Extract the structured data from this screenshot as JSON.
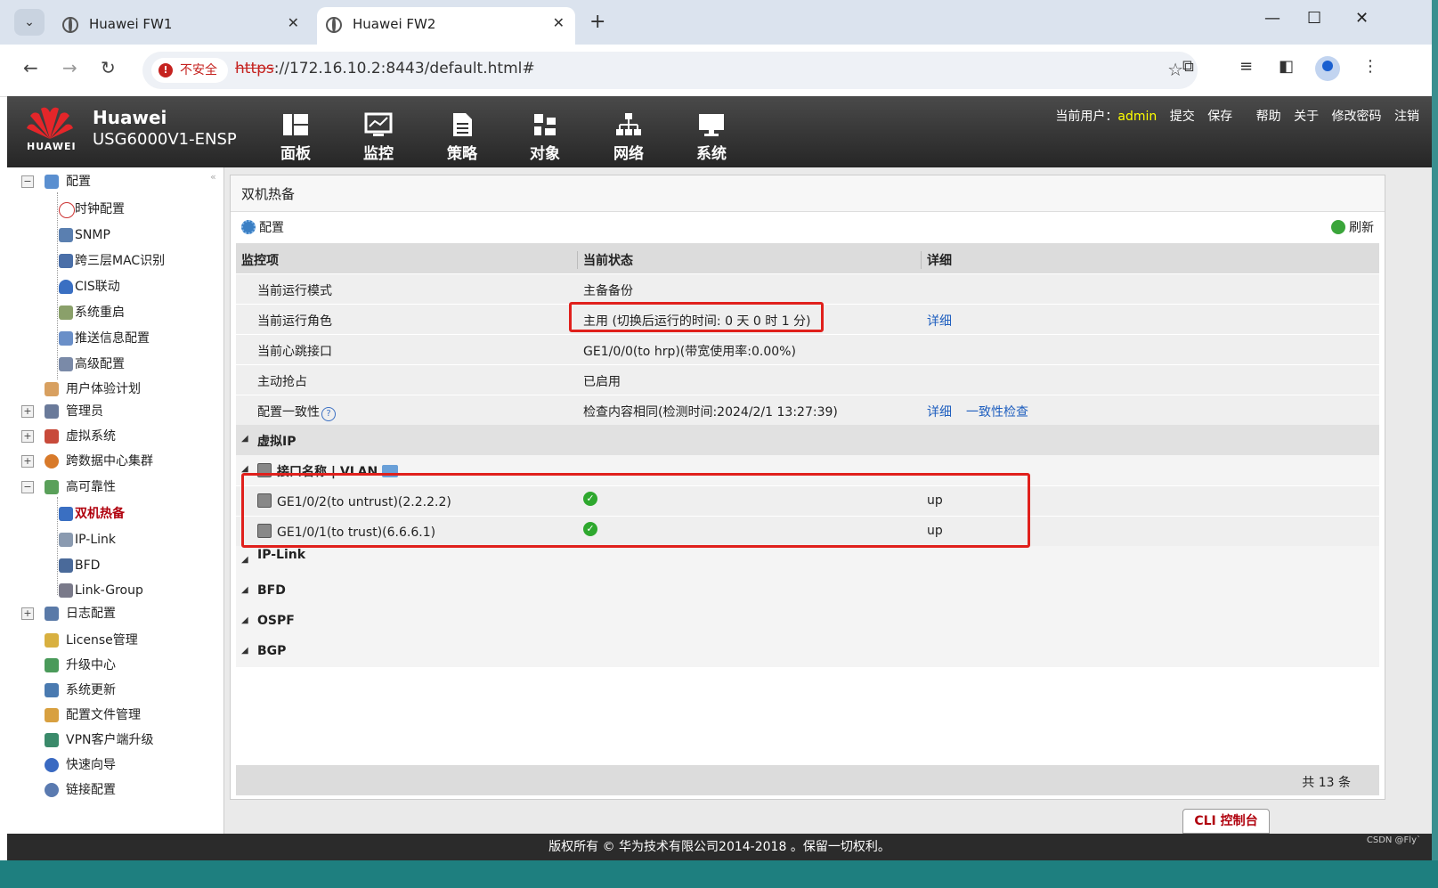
{
  "browser": {
    "tabs": [
      {
        "title": "Huawei FW1"
      },
      {
        "title": "Huawei FW2"
      }
    ],
    "security_label": "不安全",
    "url_scheme": "https",
    "url_rest": "://172.16.10.2:8443/default.html#"
  },
  "app": {
    "brand_logo_text": "HUAWEI",
    "brand_name": "Huawei",
    "model": "USG6000V1-ENSP",
    "nav": [
      "面板",
      "监控",
      "策略",
      "对象",
      "网络",
      "系统"
    ],
    "user_label": "当前用户：",
    "user_name": "admin",
    "user_links": [
      "提交",
      "保存",
      "帮助",
      "关于",
      "修改密码",
      "注销"
    ]
  },
  "sidebar": {
    "items": [
      {
        "label": "配置"
      },
      {
        "label": "时钟配置"
      },
      {
        "label": "SNMP"
      },
      {
        "label": "跨三层MAC识别"
      },
      {
        "label": "CIS联动"
      },
      {
        "label": "系统重启"
      },
      {
        "label": "推送信息配置"
      },
      {
        "label": "高级配置"
      },
      {
        "label": "用户体验计划"
      },
      {
        "label": "管理员"
      },
      {
        "label": "虚拟系统"
      },
      {
        "label": "跨数据中心集群"
      },
      {
        "label": "高可靠性"
      },
      {
        "label": "双机热备"
      },
      {
        "label": "IP-Link"
      },
      {
        "label": "BFD"
      },
      {
        "label": "Link-Group"
      },
      {
        "label": "日志配置"
      },
      {
        "label": "License管理"
      },
      {
        "label": "升级中心"
      },
      {
        "label": "系统更新"
      },
      {
        "label": "配置文件管理"
      },
      {
        "label": "VPN客户端升级"
      },
      {
        "label": "快速向导"
      },
      {
        "label": "链接配置"
      }
    ]
  },
  "main": {
    "panel_title": "双机热备",
    "config_label": "配置",
    "refresh_label": "刷新",
    "columns": [
      "监控项",
      "当前状态",
      "详细"
    ],
    "rows": [
      {
        "item": "当前运行模式",
        "status": "主备备份",
        "detail": ""
      },
      {
        "item": "当前运行角色",
        "status": "主用 (切换后运行的时间: 0 天 0 时 1 分)",
        "detail": "详细"
      },
      {
        "item": "当前心跳接口",
        "status": "GE1/0/0(to hrp)(带宽使用率:0.00%)",
        "detail": ""
      },
      {
        "item": "主动抢占",
        "status": "已启用",
        "detail": ""
      },
      {
        "item": "配置一致性",
        "status": "检查内容相同(检测时间:2024/2/1 13:27:39)",
        "detail": "详细",
        "detail2": "一致性检查"
      }
    ],
    "group_vip": "虚拟IP",
    "group_iface": "接口名称 | VLAN",
    "interfaces": [
      {
        "name": "GE1/0/2(to untrust)(2.2.2.2)",
        "state": "up"
      },
      {
        "name": "GE1/0/1(to trust)(6.6.6.1)",
        "state": "up"
      }
    ],
    "groups_after": [
      "IP-Link",
      "BFD",
      "OSPF",
      "BGP"
    ],
    "total": "共 13 条",
    "cli_button": "CLI 控制台"
  },
  "footer": {
    "copyright": "版权所有 © 华为技术有限公司2014-2018 。保留一切权利。",
    "watermark": "CSDN @Fly`"
  }
}
